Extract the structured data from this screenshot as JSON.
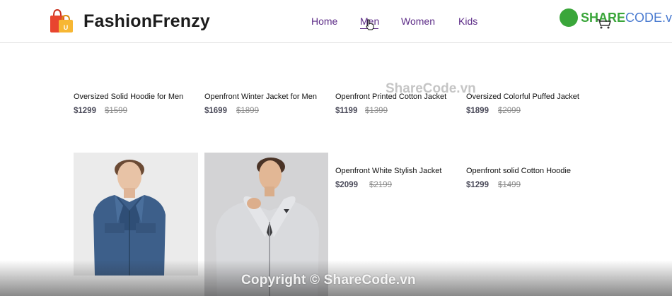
{
  "header": {
    "brand": "FashionFrenzy",
    "nav": [
      "Home",
      "Men",
      "Women",
      "Kids"
    ]
  },
  "watermark": {
    "logo_share": "SHARE",
    "logo_code": "CODE.vn",
    "center": "ShareCode.vn",
    "copyright": "Copyright © ShareCode.vn"
  },
  "products": [
    {
      "title": "Oversized Solid Hoodie for Men",
      "price": "$1299",
      "old_price": "$1599"
    },
    {
      "title": "Openfront Winter Jacket for Men",
      "price": "$1699",
      "old_price": "$1899"
    },
    {
      "title": "Openfront Printed Cotton Jacket",
      "price": "$1199",
      "old_price": "$1399"
    },
    {
      "title": "Oversized Colorful Puffed Jacket",
      "price": "$1899",
      "old_price": "$2099"
    },
    {
      "title": "Openfront White Stylish Jacket",
      "price": "$2099",
      "old_price": "$2199"
    },
    {
      "title": "Openfront solid Cotton Hoodie",
      "price": "$1299",
      "old_price": "$1499"
    }
  ],
  "colors": {
    "nav": "#5b2a86",
    "price": "#4b4b5a",
    "old_price": "#8a8a8a",
    "watermark_green": "#3aa63a"
  }
}
